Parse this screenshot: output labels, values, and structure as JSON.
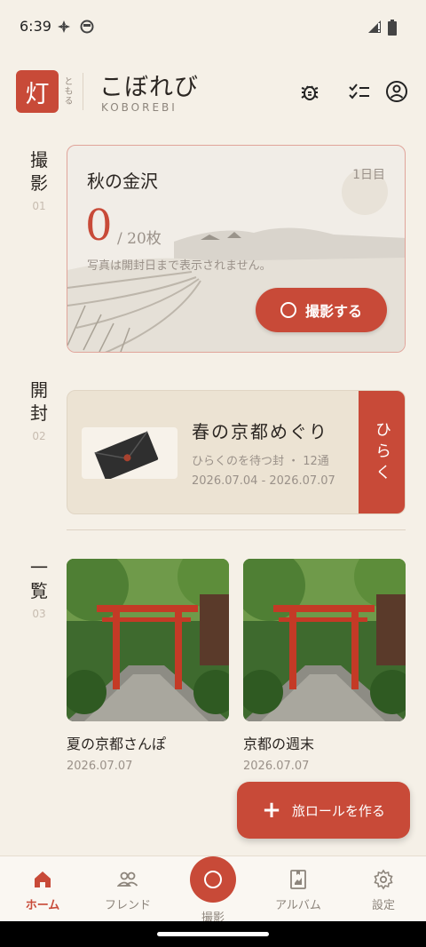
{
  "status": {
    "time": "6:39"
  },
  "header": {
    "logo_char": "灯",
    "logo_sub": "ともる",
    "title": "こぼれび",
    "subtitle": "KOBOREBI",
    "icons": [
      "bug-icon",
      "checklist-icon",
      "account-icon"
    ]
  },
  "sections": {
    "capture": {
      "chars": [
        "撮",
        "影"
      ],
      "num": "01"
    },
    "open": {
      "chars": [
        "開",
        "封"
      ],
      "num": "02"
    },
    "list": {
      "chars": [
        "一",
        "覧"
      ],
      "num": "03"
    }
  },
  "capture_card": {
    "title": "秋の金沢",
    "day": "1日目",
    "count": "0",
    "total": "/ 20枚",
    "note": "写真は開封日まで表示されません。",
    "button": "撮影する"
  },
  "open_card": {
    "title": "春の京都めぐり",
    "meta": "ひらくのを待つ封 ・ 12通",
    "dates": "2026.07.04 - 2026.07.07",
    "button": "ひらく"
  },
  "albums": [
    {
      "name": "夏の京都さんぽ",
      "date": "2026.07.07"
    },
    {
      "name": "京都の週末",
      "date": "2026.07.07"
    }
  ],
  "fab": {
    "label": "旅ロールを作る"
  },
  "nav": {
    "home": "ホーム",
    "friends": "フレンド",
    "shoot": "撮影",
    "album": "アルバム",
    "settings": "設定"
  },
  "colors": {
    "accent": "#c84a38",
    "background": "#f5f0e7",
    "card": "#ece3d3"
  }
}
